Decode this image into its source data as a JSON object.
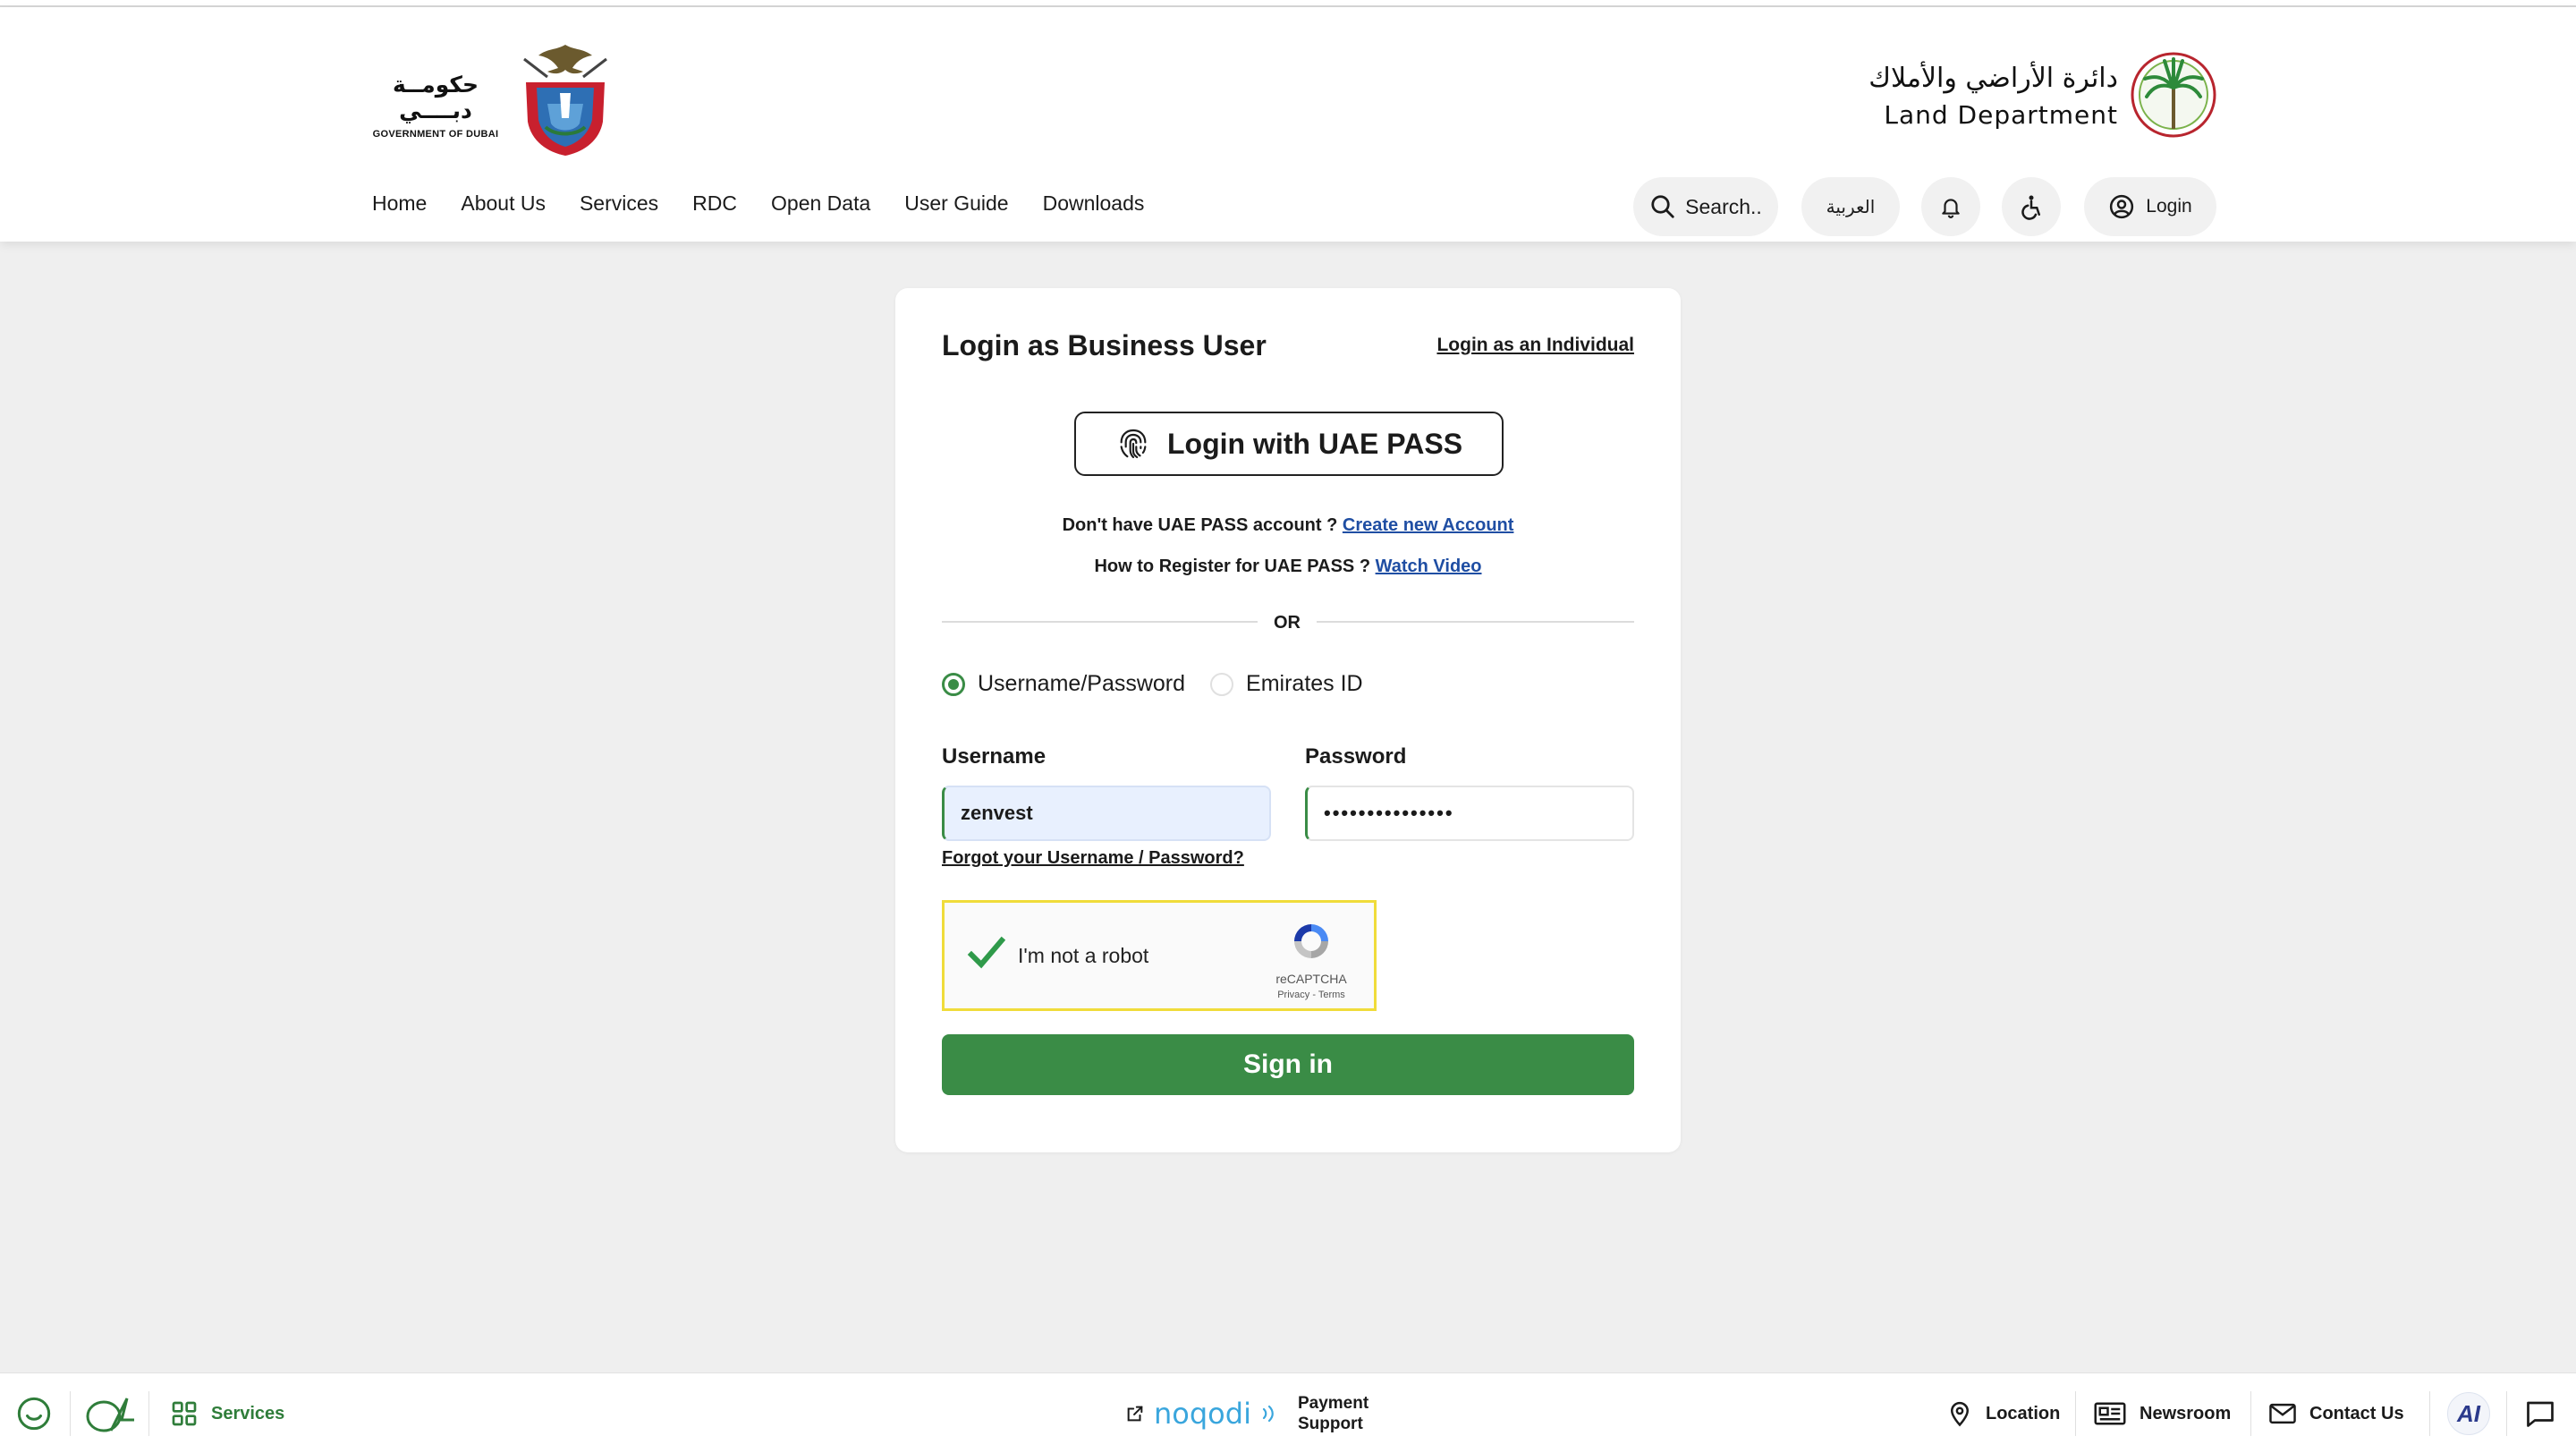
{
  "header": {
    "gov_logo": {
      "arabic": "حكومــة دبــــي",
      "english": "GOVERNMENT OF DUBAI"
    },
    "dld_logo": {
      "arabic": "دائرة الأراضي والأملاك",
      "english": "Land Department"
    },
    "nav": [
      "Home",
      "About Us",
      "Services",
      "RDC",
      "Open Data",
      "User Guide",
      "Downloads"
    ],
    "search_label": "Search..",
    "language_label": "العربية",
    "login_label": "Login"
  },
  "login_card": {
    "title": "Login as Business User",
    "alt_login_link": "Login as an Individual",
    "uae_pass_button": "Login with UAE PASS",
    "no_account_text": "Don't have UAE PASS account ? ",
    "create_account_link": "Create new Account",
    "how_to_text": "How to Register for UAE PASS ? ",
    "watch_video_link": "Watch Video",
    "or_label": "OR",
    "login_methods": [
      {
        "label": "Username/Password",
        "selected": true
      },
      {
        "label": "Emirates ID",
        "selected": false
      }
    ],
    "username_label": "Username",
    "username_value": "zenvest",
    "password_label": "Password",
    "password_value": "•••••••••••••••",
    "forgot_link": "Forgot your Username / Password?",
    "captcha": {
      "label": "I'm not a robot",
      "brand": "reCAPTCHA",
      "links": "Privacy - Terms",
      "checked": true
    },
    "signin_button": "Sign in"
  },
  "footer": {
    "services_label": "Services",
    "noqodi_brand": "noqodi",
    "payment_support_line1": "Payment",
    "payment_support_line2": "Support",
    "location_label": "Location",
    "newsroom_label": "Newsroom",
    "contact_label": "Contact Us",
    "ai_label": "AI"
  },
  "colors": {
    "primary_green": "#3a8c46",
    "link_blue": "#1f4ea3",
    "page_background": "#efefef",
    "captcha_border": "#f0dc3a",
    "noqodi_blue": "#3aa6dd"
  }
}
